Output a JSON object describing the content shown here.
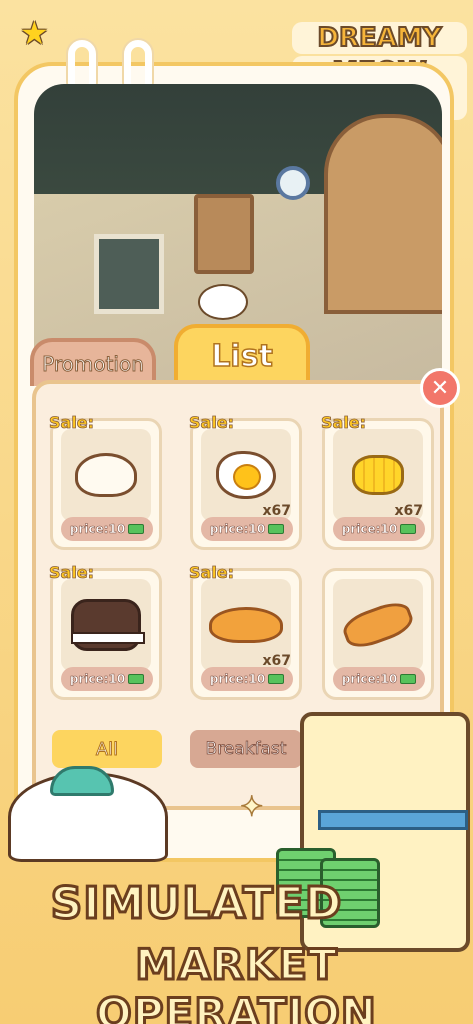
{
  "logo": {
    "line1": "DREAMY",
    "line2": "MEOW MART"
  },
  "tabs": {
    "promotion": "Promotion",
    "list": "List"
  },
  "products": [
    {
      "sale": "Sale:",
      "qty": "",
      "price": "price:10",
      "food": "steamed-bun"
    },
    {
      "sale": "Sale:",
      "qty": "x67",
      "price": "price:10",
      "food": "fried-egg"
    },
    {
      "sale": "Sale:",
      "qty": "x67",
      "price": "price:10",
      "food": "corn"
    },
    {
      "sale": "Sale:",
      "qty": "",
      "price": "price:10",
      "food": "chocolate-sandwich"
    },
    {
      "sale": "Sale:",
      "qty": "x67",
      "price": "price:10",
      "food": "croissant"
    },
    {
      "sale": "",
      "qty": "",
      "price": "price:10",
      "food": "bread-loaf"
    }
  ],
  "categories": {
    "all": "All",
    "breakfast": "Breakfast"
  },
  "banner": {
    "line1": "SIMULATED",
    "line2": "MARKET OPERATION"
  },
  "colors": {
    "accent": "#fdd55f",
    "price_pill": "#e4b8a6",
    "close": "#f2766a"
  }
}
